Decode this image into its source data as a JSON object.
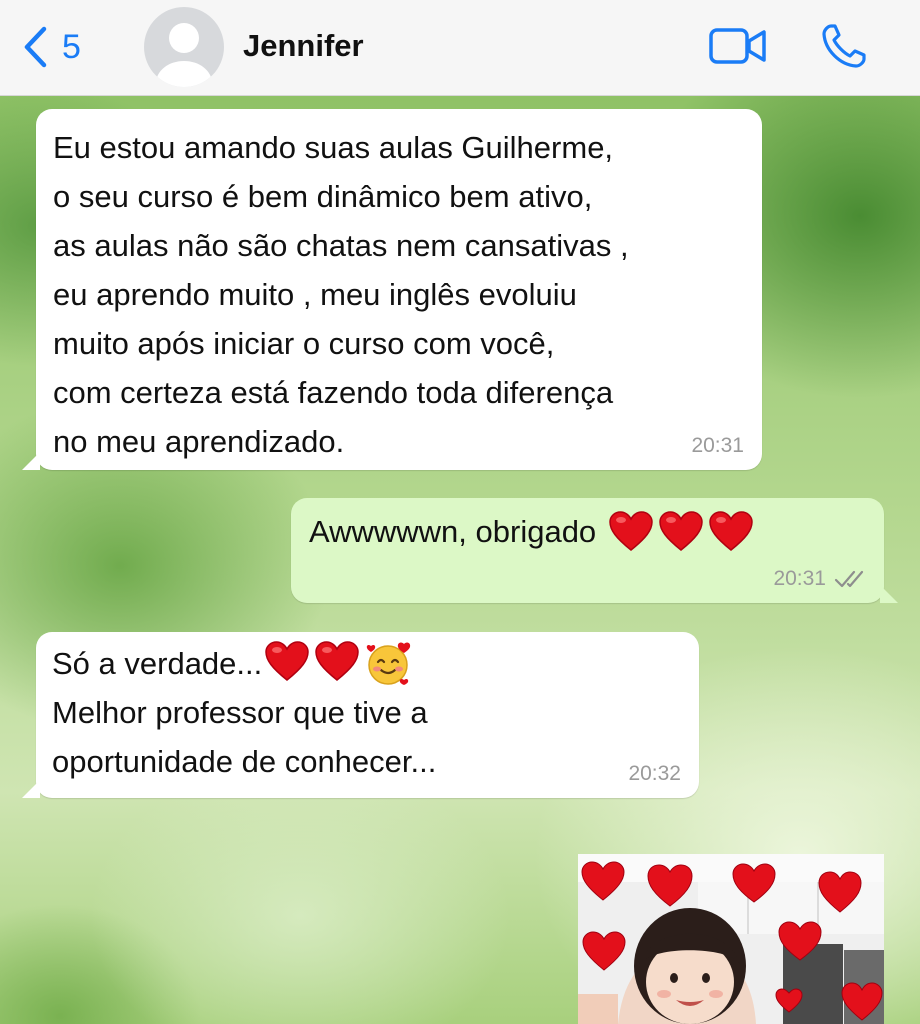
{
  "header": {
    "back_count": "5",
    "contact_name": "Jennifer"
  },
  "messages": [
    {
      "direction": "incoming",
      "text": "Eu estou amando suas aulas Guilherme,\no seu curso é bem dinâmico bem ativo,\nas aulas não são chatas nem cansativas ,\neu aprendo muito , meu inglês evoluiu\nmuito após iniciar o curso com você,\ncom certeza está fazendo toda diferença\nno meu aprendizado.",
      "time": "20:31"
    },
    {
      "direction": "outgoing",
      "text": "Awwwwwn, obrigado",
      "emoji": [
        "heart",
        "heart",
        "heart"
      ],
      "time": "20:31",
      "status": "read"
    },
    {
      "direction": "incoming",
      "line1": "Só a verdade...",
      "emoji": [
        "heart",
        "heart",
        "smiling-face-with-hearts"
      ],
      "text_rest": "Melhor professor que tive a\noportunidade de conhecer...",
      "time": "20:32"
    },
    {
      "direction": "incoming",
      "type": "image",
      "image_description_icon": "sticker-photo"
    }
  ],
  "colors": {
    "accent": "#1a7cf6",
    "incoming_bubble": "#ffffff",
    "outgoing_bubble": "#dcf8c6",
    "heart": "#e3101b"
  }
}
